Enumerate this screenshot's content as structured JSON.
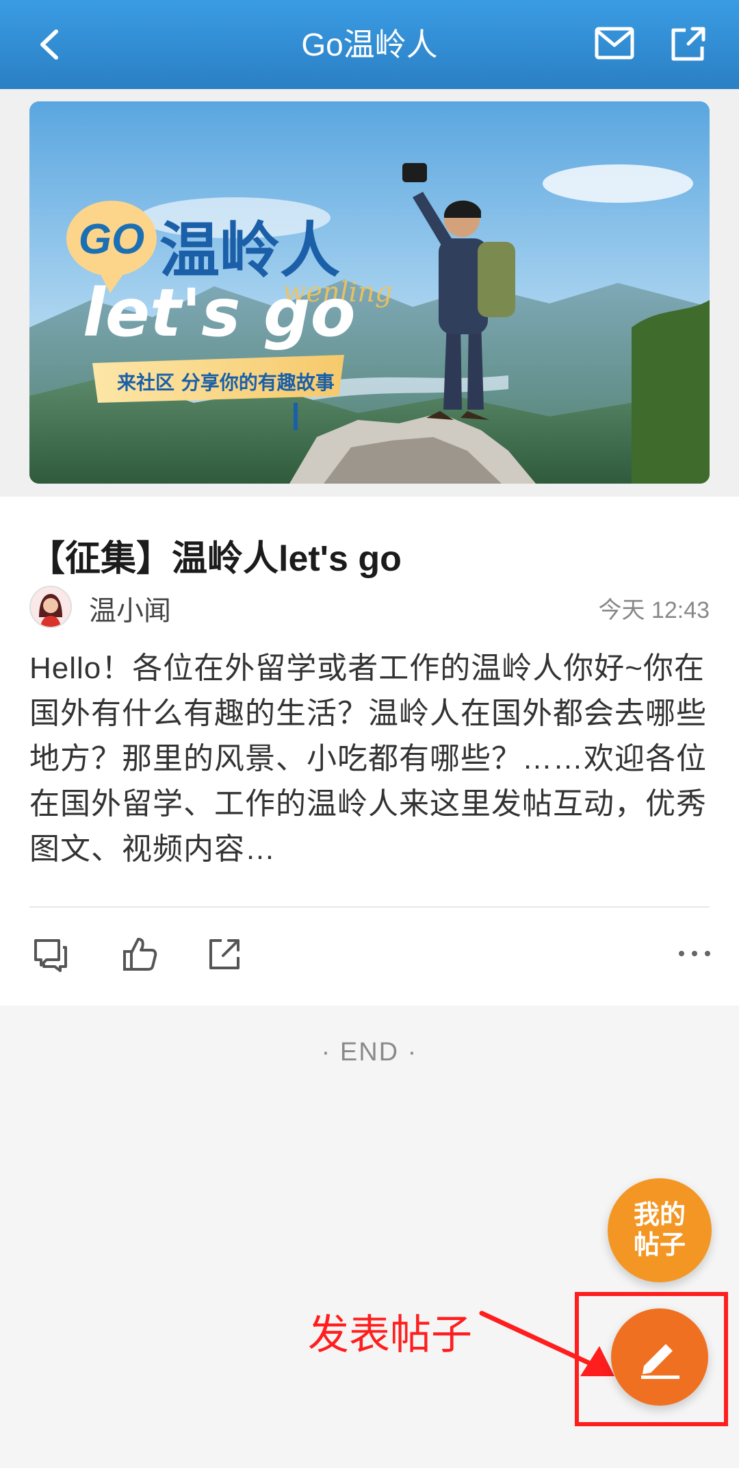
{
  "header": {
    "title": "Go温岭人"
  },
  "banner": {
    "logo_go": "GO",
    "logo_title": "温岭人",
    "logo_sub": "wenling",
    "slogan": "let's go",
    "tagline": "来社区 分享你的有趣故事"
  },
  "post": {
    "title": "【征集】温岭人let's go",
    "author": "温小闻",
    "time": "今天 12:43",
    "summary": "Hello！各位在外留学或者工作的温岭人你好~你在国外有什么有趣的生活？温岭人在国外都会去哪些地方？那里的风景、小吃都有哪些？……欢迎各位在国外留学、工作的温岭人来这里发帖互动，优秀图文、视频内容…"
  },
  "end_text": "· END ·",
  "floating": {
    "my_posts_line1": "我的",
    "my_posts_line2": "帖子"
  },
  "annotation": {
    "label": "发表帖子"
  },
  "colors": {
    "header_blue": "#2b7fc4",
    "orange": "#f49624",
    "compose_orange": "#f07022",
    "annotation_red": "#ff1e1e"
  },
  "icons": {
    "back": "back-arrow-icon",
    "mail": "mail-icon",
    "share": "share-icon",
    "comment": "comment-icon",
    "like": "thumbs-up-icon",
    "post_share": "share-icon",
    "more": "more-dots-icon",
    "compose": "pencil-icon"
  }
}
